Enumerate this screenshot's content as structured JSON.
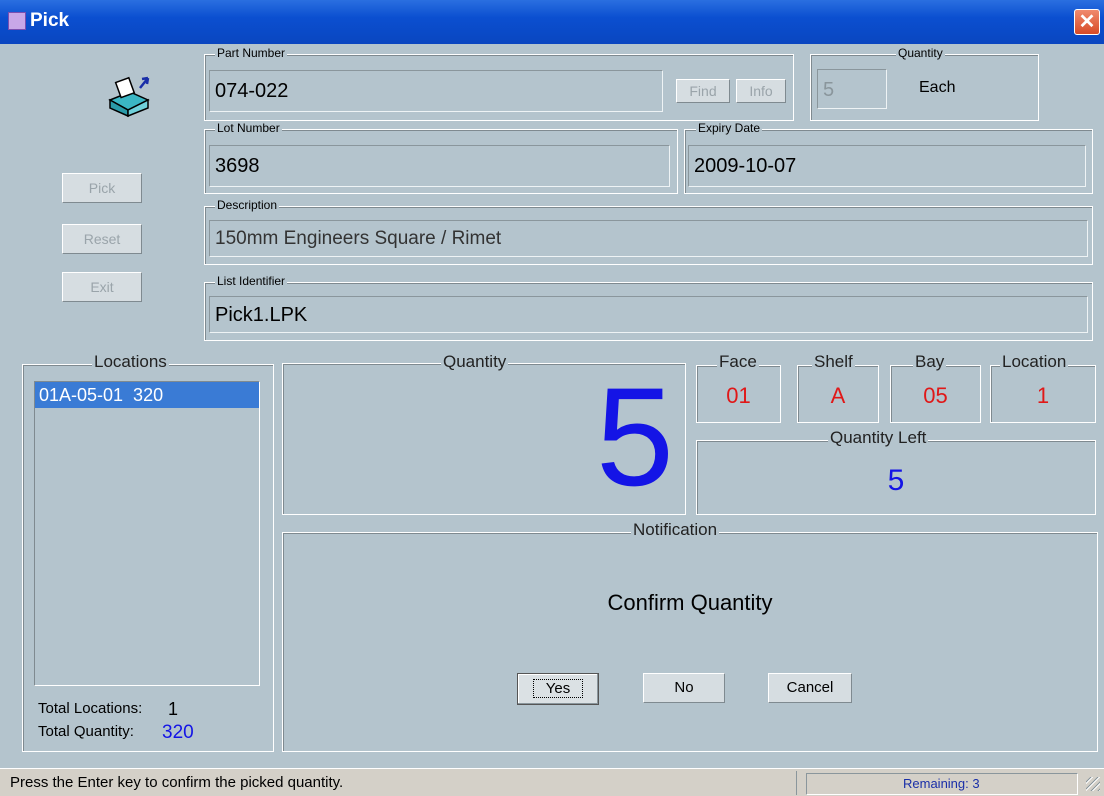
{
  "window": {
    "title": "Pick",
    "close_glyph": "✕"
  },
  "sidebar": {
    "pick_label": "Pick",
    "reset_label": "Reset",
    "exit_label": "Exit",
    "icon": "pick-box-icon"
  },
  "part": {
    "label": "Part Number",
    "value": "074-022",
    "find_label": "Find",
    "info_label": "Info"
  },
  "quantity_header": {
    "label": "Quantity",
    "value": "5",
    "unit": "Each"
  },
  "lot": {
    "label": "Lot Number",
    "value": "3698"
  },
  "expiry": {
    "label": "Expiry Date",
    "value": "2009-10-07"
  },
  "description": {
    "label": "Description",
    "value": "150mm Engineers Square / Rimet"
  },
  "list_identifier": {
    "label": "List Identifier",
    "value": "Pick1.LPK"
  },
  "locations": {
    "label": "Locations",
    "items": [
      "01A-05-01  320"
    ],
    "total_locations_label": "Total Locations:",
    "total_locations_value": "1",
    "total_quantity_label": "Total Quantity:",
    "total_quantity_value": "320"
  },
  "pick_quantity": {
    "label": "Quantity",
    "value": "5"
  },
  "position": {
    "face_label": "Face",
    "face_value": "01",
    "shelf_label": "Shelf",
    "shelf_value": "A",
    "bay_label": "Bay",
    "bay_value": "05",
    "location_label": "Location",
    "location_value": "1"
  },
  "quantity_left": {
    "label": "Quantity Left",
    "value": "5"
  },
  "notification": {
    "label": "Notification",
    "message": "Confirm Quantity",
    "yes_label": "Yes",
    "no_label": "No",
    "cancel_label": "Cancel"
  },
  "statusbar": {
    "message": "Press the Enter key to confirm the picked quantity.",
    "remaining": "Remaining: 3"
  },
  "colors": {
    "title_bar": "#0b4fd0",
    "background": "#b4c4cd",
    "position_red": "#e01818",
    "quantity_blue": "#1414e6",
    "selection": "#3a7bd5"
  }
}
